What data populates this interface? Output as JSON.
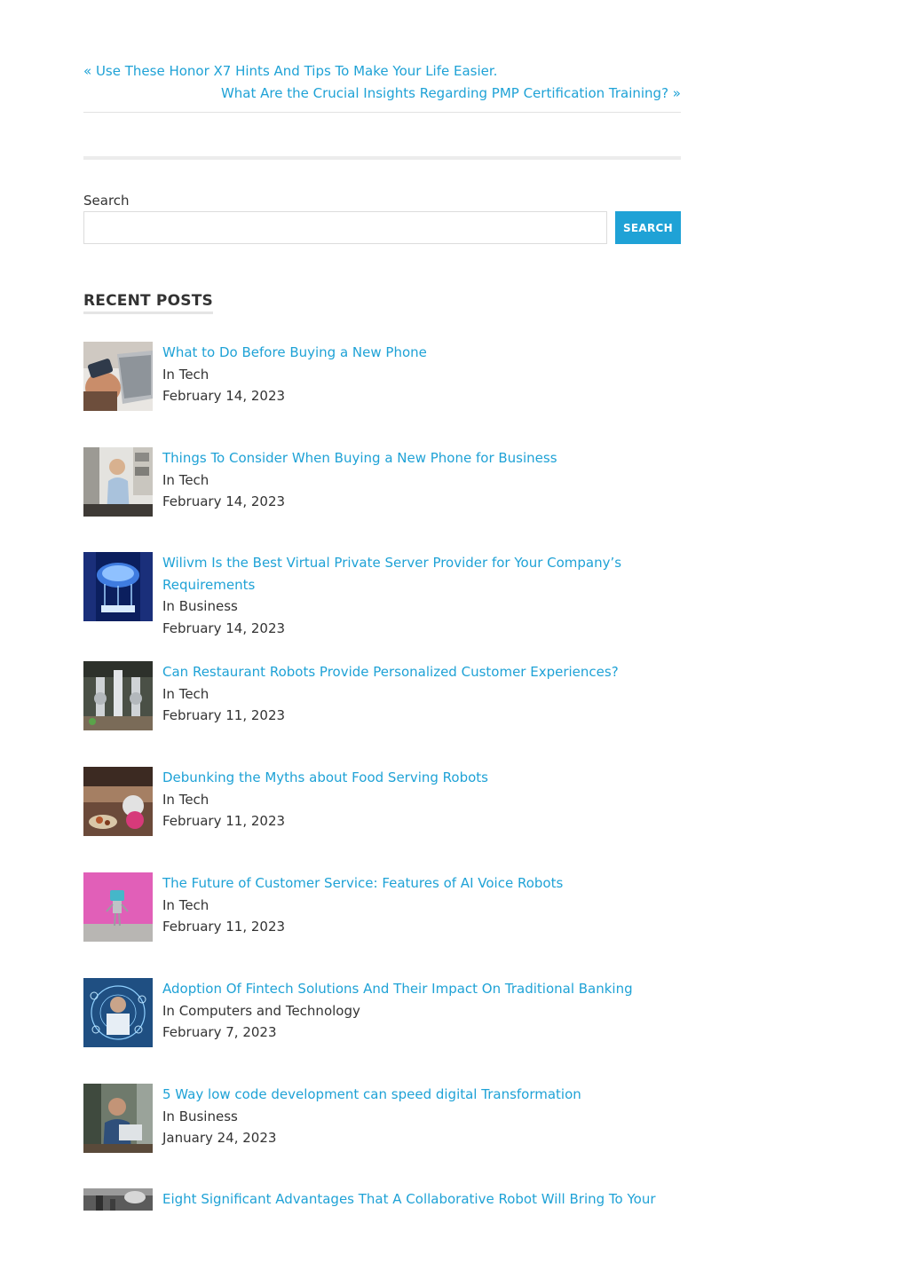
{
  "post_nav": {
    "previous": "« Use These Honor X7 Hints And Tips To Make Your Life Easier.",
    "next": "What Are the Crucial Insights Regarding PMP Certification Training? »"
  },
  "search": {
    "label": "Search",
    "value": "",
    "placeholder": "",
    "button_label": "SEARCH"
  },
  "recent_posts": {
    "heading": "RECENT POSTS",
    "items": [
      {
        "title": "What to Do Before Buying a New Phone",
        "category": "In Tech",
        "date": "February 14, 2023",
        "thumb_icon": "laptop-credit-card-photo"
      },
      {
        "title": "Things To Consider When Buying a New Phone for Business",
        "category": "In Tech",
        "date": "February 14, 2023",
        "thumb_icon": "woman-phone-office-photo"
      },
      {
        "title": "Wilivm Is the Best Virtual Private Server Provider for Your Company’s Requirements",
        "category": "In Business",
        "date": "February 14, 2023",
        "thumb_icon": "cloud-server-photo"
      },
      {
        "title": "Can Restaurant Robots Provide Personalized Customer Experiences?",
        "category": "In Tech",
        "date": "February 11, 2023",
        "thumb_icon": "robot-arms-photo"
      },
      {
        "title": "Debunking the Myths about Food Serving Robots",
        "category": "In Tech",
        "date": "February 11, 2023",
        "thumb_icon": "restaurant-robot-photo"
      },
      {
        "title": "The Future of Customer Service: Features of AI Voice Robots",
        "category": "In Tech",
        "date": "February 11, 2023",
        "thumb_icon": "toy-robot-pink-photo"
      },
      {
        "title": "Adoption Of Fintech Solutions And Their Impact On Traditional Banking",
        "category": "In Computers and Technology",
        "date": "February 7, 2023",
        "thumb_icon": "fintech-hologram-photo"
      },
      {
        "title": "5 Way low code development can speed digital Transformation",
        "category": "In Business",
        "date": "January 24, 2023",
        "thumb_icon": "man-laptop-photo"
      },
      {
        "title": "Eight Significant Advantages That A Collaborative Robot Will Bring To Your",
        "category": "",
        "date": "",
        "thumb_icon": "cobot-photo"
      }
    ]
  },
  "colors": {
    "link": "#1fa2d6",
    "text": "#333333",
    "button": "#1fa2d6"
  }
}
